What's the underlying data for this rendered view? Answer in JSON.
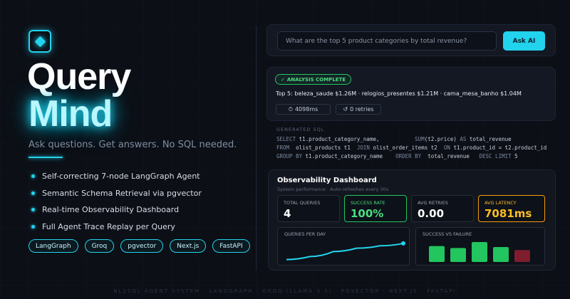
{
  "brand": {
    "title_line1": "Query",
    "title_line2": "Mind",
    "tagline": "Ask questions. Get answers. No SQL needed."
  },
  "features": [
    "Self-correcting 7-node LangGraph Agent",
    "Semantic Schema Retrieval via pgvector",
    "Real-time Observability Dashboard",
    "Full Agent Trace Replay per Query"
  ],
  "tech_chips": [
    "LangGraph",
    "Groq",
    "pgvector",
    "Next.js",
    "FastAPI"
  ],
  "search": {
    "placeholder": "What are the top 5 product categories by total revenue?",
    "button_label": "Ask AI"
  },
  "result": {
    "status_badge": "ANALYSIS COMPLETE",
    "answer": "Top 5: beleza_saude $1.26M · relogios_presentes $1.21M · cama_mesa_banho $1.04M",
    "latency": "4098ms",
    "retries": "0 retries"
  },
  "sql": {
    "label": "GENERATED SQL",
    "lines": [
      [
        "SELECT",
        " t1.product_category_name,           ",
        "SUM",
        "(t2.price) ",
        "AS",
        " total_revenue"
      ],
      [
        "FROM",
        "  olist_products t1  ",
        "JOIN",
        " olist_order_items t2  ",
        "ON",
        " t1.product_id = t2.product_id"
      ],
      [
        "GROUP BY",
        " t1.product_category_name    ",
        "ORDER BY",
        "  total_revenue   ",
        "DESC LIMIT",
        " 5"
      ]
    ]
  },
  "dashboard": {
    "title": "Observability Dashboard",
    "subtitle": "System performance · Auto-refreshes every 30s",
    "kpis": [
      {
        "label": "TOTAL QUERIES",
        "value": "4"
      },
      {
        "label": "SUCCESS RATE",
        "value": "100%"
      },
      {
        "label": "AVG RETRIES",
        "value": "0.00"
      },
      {
        "label": "AVG LATENCY",
        "value": "7081ms"
      }
    ],
    "queries_per_day_label": "QUERIES PER DAY",
    "success_failure_label": "SUCCESS VS FAILURE",
    "queries_per_day": [
      0.05,
      0.2,
      0.45,
      0.62,
      0.74,
      0.86
    ],
    "success_bars": [
      {
        "value": 0.8,
        "kind": "success"
      },
      {
        "value": 0.7,
        "kind": "success"
      },
      {
        "value": 1.0,
        "kind": "success"
      },
      {
        "value": 0.75,
        "kind": "success"
      },
      {
        "value": 0.6,
        "kind": "failure"
      }
    ]
  },
  "footer": "NL2SQL AGENT SYSTEM · LANGGRAPH · GROQ (LLAMA 3.3) · PGVECTOR · NEXT.JS · FASTAPI",
  "colors": {
    "accent": "#22d3ee",
    "success": "#22c55e",
    "warning": "#f59e0b",
    "failure": "#7f1d2d"
  }
}
